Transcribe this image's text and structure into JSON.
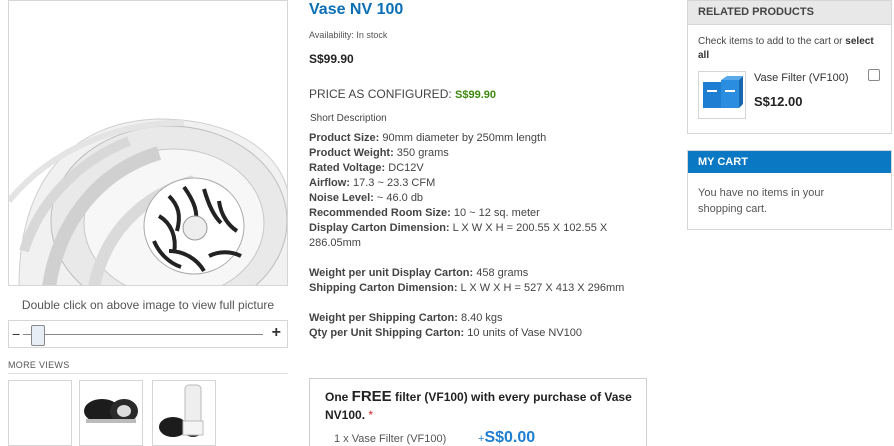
{
  "gallery": {
    "zoom_hint": "Double click on above image to view full picture",
    "zoom_minus": "−",
    "zoom_plus": "+",
    "more_views_title": "MORE VIEWS"
  },
  "product": {
    "name": "Vase NV 100",
    "availability": "Availability: In stock",
    "price": "S$99.90",
    "configured_label": "PRICE AS CONFIGURED:",
    "configured_price": "S$99.90",
    "short_desc_title": "Short Description",
    "specs": [
      {
        "label": "Product Size:",
        "value": " 90mm diameter by 250mm length"
      },
      {
        "label": "Product Weight:",
        "value": " 350 grams"
      },
      {
        "label": "Rated Voltage:",
        "value": " DC12V"
      },
      {
        "label": "Airflow:",
        "value": " 17.3 ~ 23.3 CFM"
      },
      {
        "label": "Noise Level:",
        "value": " ~ 46.0 db"
      },
      {
        "label": "Recommended Room Size:",
        "value": " 10 ~ 12 sq. meter"
      },
      {
        "label": "Display Carton Dimension:",
        "value": " L X W X H = 200.55 X 102.55 X 286.05mm"
      }
    ],
    "specs2": [
      {
        "label": "Weight per unit Display Carton:",
        "value": " 458 grams"
      },
      {
        "label": "Shipping Carton Dimension:",
        "value": " L X W X H = 527 X 413 X 296mm"
      }
    ],
    "specs3": [
      {
        "label": "Weight per Shipping Carton:",
        "value": " 8.40 kgs"
      },
      {
        "label": "Qty per Unit Shipping Carton:",
        "value": " 10 units of Vase NV100"
      }
    ]
  },
  "offer": {
    "title_pre": "One ",
    "title_free": "FREE",
    "title_post": " filter (VF100) with every purchase of Vase NV100.",
    "required_mark": " *",
    "line_label": "1 x Vase Filter (VF100)",
    "price_prefix": "+",
    "price": "S$0.00"
  },
  "related": {
    "title": "RELATED PRODUCTS",
    "hint_pre": "Check items to add to the cart or ",
    "hint_link": "select all",
    "item_name": "Vase Filter (VF100)",
    "item_price": "S$12.00"
  },
  "cart": {
    "title": "MY CART",
    "empty_text": "You have no items in your shopping cart."
  },
  "colors": {
    "link_blue": "#0a6fb4",
    "green_price": "#3d8a0e",
    "cart_header": "#0a78c2"
  }
}
